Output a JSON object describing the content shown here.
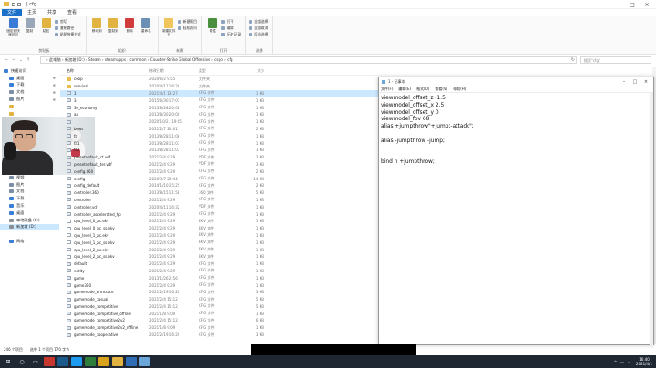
{
  "window": {
    "title": "| cfg"
  },
  "tabs": [
    "文件",
    "主页",
    "共享",
    "查看"
  ],
  "ribbon": {
    "groups": [
      {
        "label": "剪贴板",
        "big": [
          {
            "label": "固定到快速访问",
            "color": "#3a7bd5"
          },
          {
            "label": "复制",
            "color": "#9aa7b8"
          },
          {
            "label": "粘贴",
            "color": "#e3b341"
          }
        ],
        "small": [
          "剪切",
          "复制路径",
          "粘贴快捷方式"
        ]
      },
      {
        "label": "组织",
        "big": [
          {
            "label": "移动到",
            "color": "#e3b341"
          },
          {
            "label": "复制到",
            "color": "#e3b341"
          },
          {
            "label": "删除",
            "color": "#d23b3b"
          },
          {
            "label": "重命名",
            "color": "#6c8fb6"
          }
        ],
        "small": []
      },
      {
        "label": "新建",
        "big": [
          {
            "label": "新建文件夹",
            "color": "#f0c65c"
          }
        ],
        "small": [
          "新建项目",
          "轻松访问"
        ]
      },
      {
        "label": "打开",
        "big": [
          {
            "label": "属性",
            "color": "#4a8f3d"
          }
        ],
        "small": [
          "打开",
          "编辑",
          "历史记录"
        ]
      },
      {
        "label": "选择",
        "big": [],
        "small": [
          "全部选择",
          "全部取消",
          "反向选择"
        ]
      }
    ]
  },
  "address": {
    "path": "› 此电脑  ›  新加坡 (D:)  ›  Steam  ›  steamapps  ›  common  ›  Counter-Strike Global Offensive  ›  csgo  ›  cfg",
    "search_placeholder": "搜索\"cfg\""
  },
  "nav": [
    {
      "label": "快速访问",
      "color": "#3b7fd6",
      "pin": false
    },
    {
      "label": "桌面",
      "color": "#3b7fd6",
      "pin": true
    },
    {
      "label": "下载",
      "color": "#3b7fd6",
      "pin": true
    },
    {
      "label": "文档",
      "color": "#7c8ea6",
      "pin": true
    },
    {
      "label": "图片",
      "color": "#7c8ea6",
      "pin": true
    },
    {
      "label": "",
      "color": "#e3b341",
      "pin": false
    },
    {
      "label": "",
      "color": "#e3b341",
      "pin": false
    },
    {
      "label": "",
      "color": "#e3b341",
      "pin": false
    },
    {
      "label": "",
      "color": "#e3b341",
      "pin": false
    },
    {
      "label": "",
      "color": "#e3b341",
      "pin": false
    },
    {
      "label": "",
      "color": "#e3b341",
      "pin": false
    },
    {
      "label": "",
      "color": "#e3b341",
      "pin": false
    },
    {
      "label": "",
      "color": "#e3b341",
      "pin": false
    },
    {
      "label": "",
      "color": "#e3b341",
      "pin": false
    },
    {
      "label": "",
      "color": "#3b7fd6",
      "pin": false
    },
    {
      "label": "视频",
      "color": "#7c8ea6",
      "pin": false
    },
    {
      "label": "图片",
      "color": "#7c8ea6",
      "pin": false
    },
    {
      "label": "文档",
      "color": "#7c8ea6",
      "pin": false
    },
    {
      "label": "下载",
      "color": "#3b7fd6",
      "pin": false
    },
    {
      "label": "音乐",
      "color": "#3b7fd6",
      "pin": false
    },
    {
      "label": "桌面",
      "color": "#3b7fd6",
      "pin": false
    },
    {
      "label": "本地磁盘 (C:)",
      "color": "#8a8f96",
      "pin": false
    },
    {
      "label": "新加坡 (D:)",
      "color": "#8a8f96",
      "pin": false,
      "sel": true
    },
    {
      "label": "",
      "color": "#ffffff",
      "pin": false
    },
    {
      "label": "网络",
      "color": "#3b7fd6",
      "pin": false
    }
  ],
  "columns": {
    "name": "名称",
    "date": "修改日期",
    "type": "类型",
    "size": "大小"
  },
  "files": [
    {
      "name": "coop",
      "date": "2020/6/2 9:55",
      "type": "文件夹",
      "size": "",
      "kind": "folder"
    },
    {
      "name": "survival",
      "date": "2020/4/11 16:28",
      "type": "文件夹",
      "size": "",
      "kind": "folder"
    },
    {
      "name": "1",
      "date": "2021/4/1 13:27",
      "type": "CFG 文件",
      "size": "1 KB",
      "kind": "cfg",
      "sel": true
    },
    {
      "name": "3",
      "date": "2015/6/30 17:01",
      "type": "CFG 文件",
      "size": "1 KB",
      "kind": "cfg"
    },
    {
      "name": "3e_economy",
      "date": "2013/8/28 20:08",
      "type": "CFG 文件",
      "size": "1 KB",
      "kind": "cfg"
    },
    {
      "name": "aa",
      "date": "2013/8/30 20:00",
      "type": "CFG 文件",
      "size": "1 KB",
      "kind": "cfg"
    },
    {
      "name": "",
      "date": "2020/10/21 19:05",
      "type": "CFG 文件",
      "size": "1 KB",
      "kind": "cfg"
    },
    {
      "name": "bews",
      "date": "2021/2/7 20:01",
      "type": "CFG 文件",
      "size": "2 KB",
      "kind": "cfg"
    },
    {
      "name": "fa",
      "date": "2013/8/28 11:08",
      "type": "CFG 文件",
      "size": "1 KB",
      "kind": "cfg"
    },
    {
      "name": "fa1",
      "date": "2013/8/28 11:07",
      "type": "CFG 文件",
      "size": "1 KB",
      "kind": "cfg"
    },
    {
      "name": "fa2",
      "date": "2013/8/28 11:07",
      "type": "CFG 文件",
      "size": "1 KB",
      "kind": "cfg"
    },
    {
      "name": "presetdefault_ct.vdf",
      "date": "2021/2/4 9:29",
      "type": "VDF 文件",
      "size": "3 KB",
      "kind": "cfg"
    },
    {
      "name": "presetdefault_ter.vdf",
      "date": "2021/2/4 9:29",
      "type": "VDF 文件",
      "size": "3 KB",
      "kind": "cfg"
    },
    {
      "name": "config.360",
      "date": "2021/2/4 9:29",
      "type": "CFG 文件",
      "size": "2 KB",
      "kind": "cfg"
    },
    {
      "name": "config",
      "date": "2020/3/7 20:44",
      "type": "CFG 文件",
      "size": "14 KB",
      "kind": "cfg"
    },
    {
      "name": "config_default",
      "date": "2014/1/10 15:25",
      "type": "CFG 文件",
      "size": "2 KB",
      "kind": "cfg"
    },
    {
      "name": "controller.360",
      "date": "2013/8/15 11:58",
      "type": "360 文件",
      "size": "5 KB",
      "kind": "cfg"
    },
    {
      "name": "controller",
      "date": "2021/2/4 9:29",
      "type": "CFG 文件",
      "size": "1 KB",
      "kind": "cfg"
    },
    {
      "name": "controller.vdf",
      "date": "2020/4/11 16:32",
      "type": "VDF 文件",
      "size": "1 KB",
      "kind": "cfg"
    },
    {
      "name": "controller_accelerated_hp",
      "date": "2021/2/4 9:29",
      "type": "CFG 文件",
      "size": "1 KB",
      "kind": "cfg"
    },
    {
      "name": "cpu_level_0_pc.ekv",
      "date": "2021/2/4 9:29",
      "type": "EKV 文件",
      "size": "1 KB",
      "kind": "txt"
    },
    {
      "name": "cpu_level_0_pc_ss.ekv",
      "date": "2021/2/4 9:29",
      "type": "EKV 文件",
      "size": "1 KB",
      "kind": "txt"
    },
    {
      "name": "cpu_level_1_pc.ekv",
      "date": "2021/2/4 9:29",
      "type": "EKV 文件",
      "size": "1 KB",
      "kind": "txt"
    },
    {
      "name": "cpu_level_1_pc_ss.ekv",
      "date": "2021/2/4 9:29",
      "type": "EKV 文件",
      "size": "1 KB",
      "kind": "txt"
    },
    {
      "name": "cpu_level_2_pc.ekv",
      "date": "2021/2/4 9:29",
      "type": "EKV 文件",
      "size": "1 KB",
      "kind": "txt"
    },
    {
      "name": "cpu_level_2_pc_ss.ekv",
      "date": "2021/2/4 9:29",
      "type": "EKV 文件",
      "size": "1 KB",
      "kind": "txt"
    },
    {
      "name": "default",
      "date": "2021/2/4 9:29",
      "type": "CFG 文件",
      "size": "1 KB",
      "kind": "cfg"
    },
    {
      "name": "entity",
      "date": "2021/2/4 9:29",
      "type": "CFG 文件",
      "size": "1 KB",
      "kind": "cfg"
    },
    {
      "name": "game",
      "date": "2013/1/26 2:56",
      "type": "CFG 文件",
      "size": "1 KB",
      "kind": "cfg"
    },
    {
      "name": "game360",
      "date": "2021/2/4 9:29",
      "type": "CFG 文件",
      "size": "1 KB",
      "kind": "cfg"
    },
    {
      "name": "gamemode_armsrace",
      "date": "2021/2/19 16:20",
      "type": "CFG 文件",
      "size": "3 KB",
      "kind": "cfg"
    },
    {
      "name": "gamemode_casual",
      "date": "2021/2/4 15:12",
      "type": "CFG 文件",
      "size": "5 KB",
      "kind": "cfg"
    },
    {
      "name": "gamemode_competitive",
      "date": "2021/2/4 15:12",
      "type": "CFG 文件",
      "size": "5 KB",
      "kind": "cfg"
    },
    {
      "name": "gamemode_competitive_offline",
      "date": "2021/1/8 9:09",
      "type": "CFG 文件",
      "size": "1 KB",
      "kind": "cfg"
    },
    {
      "name": "gamemode_competitive2v2",
      "date": "2021/2/4 15:12",
      "type": "CFG 文件",
      "size": "6 KB",
      "kind": "cfg"
    },
    {
      "name": "gamemode_competitive2v2_offline",
      "date": "2021/1/8 9:09",
      "type": "CFG 文件",
      "size": "1 KB",
      "kind": "cfg"
    },
    {
      "name": "gamemode_cooperative",
      "date": "2021/2/19 16:20",
      "type": "CFG 文件",
      "size": "3 KB",
      "kind": "cfg"
    }
  ],
  "status": {
    "count": "246 个项目",
    "selected": "选中 1 个项目  170 字节"
  },
  "notepad": {
    "title": "1 - 记事本",
    "menu": [
      "文件(F)",
      "编辑(E)",
      "格式(O)",
      "查看(V)",
      "帮助(H)"
    ],
    "lines": [
      "viewmodel_offset_z -1.5",
      "viewmodel_offset_x 2.5",
      "viewmodel_offset_y 0",
      "viewmodel_fov 68",
      "alias +jumpthrow\"+jump;-attack\";",
      "",
      "alias -jumpthrow -jump;",
      "",
      "",
      "bind n +jumpthrow;"
    ]
  },
  "taskbar": {
    "icons": [
      {
        "name": "start",
        "color": "#1f2733",
        "glyph": "⊞"
      },
      {
        "name": "search",
        "color": "#1f2733",
        "glyph": "○"
      },
      {
        "name": "taskview",
        "color": "#1f2733",
        "glyph": "▭"
      },
      {
        "name": "app-red",
        "color": "#c8372d",
        "glyph": ""
      },
      {
        "name": "steam",
        "color": "#1b5a8a",
        "glyph": ""
      },
      {
        "name": "qq",
        "color": "#1d9bf0",
        "glyph": ""
      },
      {
        "name": "edge",
        "color": "#2f7d3b",
        "glyph": ""
      },
      {
        "name": "chrome",
        "color": "#d9a21b",
        "glyph": ""
      },
      {
        "name": "explorer",
        "color": "#e3b341",
        "glyph": ""
      },
      {
        "name": "app-blue",
        "color": "#2f6db5",
        "glyph": ""
      },
      {
        "name": "notepad",
        "color": "#6aa6d8",
        "glyph": ""
      }
    ],
    "time": "16:40",
    "date": "2021/4/1"
  }
}
